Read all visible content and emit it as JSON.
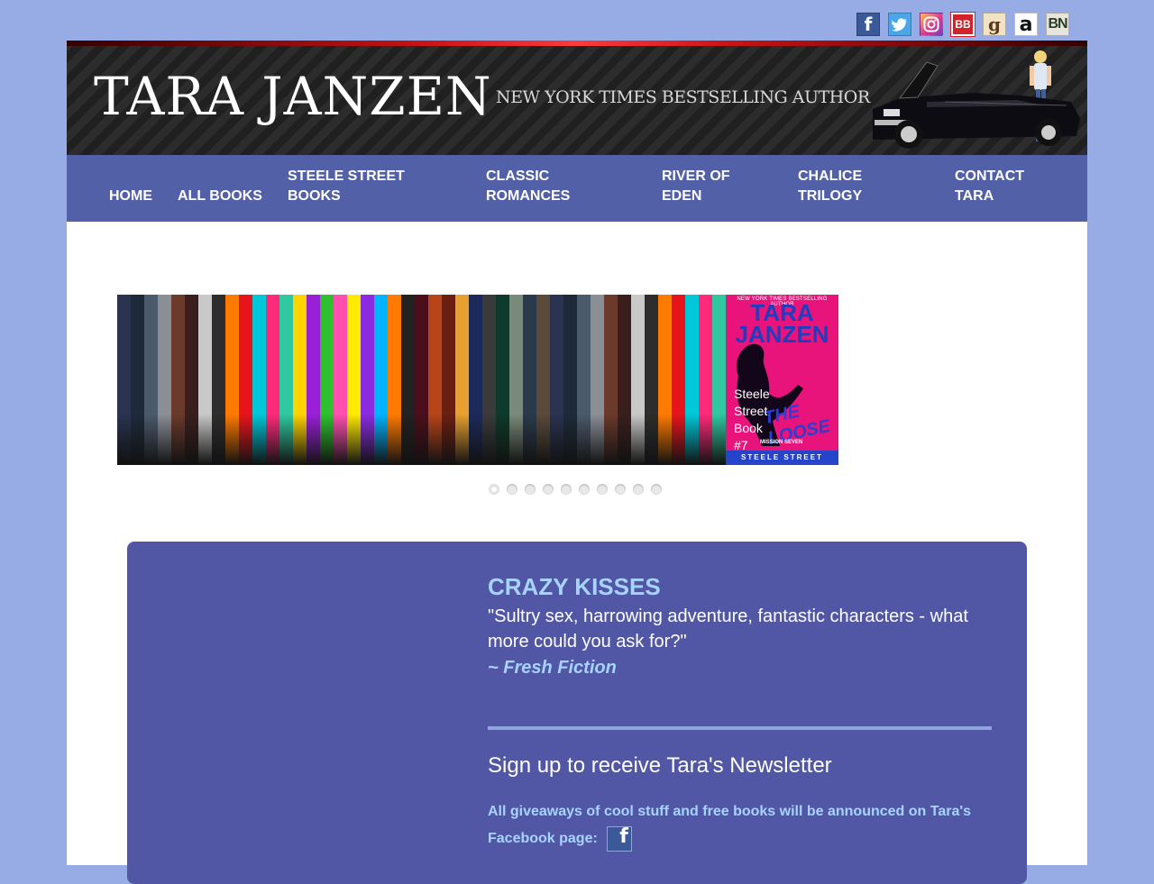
{
  "social": [
    {
      "name": "facebook-icon",
      "glyph": "f"
    },
    {
      "name": "twitter-icon",
      "glyph": "🐦"
    },
    {
      "name": "instagram-icon",
      "glyph": ""
    },
    {
      "name": "bookbub-icon",
      "glyph": "BB"
    },
    {
      "name": "goodreads-icon",
      "glyph": "g"
    },
    {
      "name": "amazon-icon",
      "glyph": "a"
    },
    {
      "name": "barnes-noble-icon",
      "glyph": "BN"
    }
  ],
  "header": {
    "brand": "TARA JANZEN",
    "tagline": "NEW YORK TIMES  BESTSELLING AUTHOR"
  },
  "nav": {
    "home": "HOME",
    "all_books": "ALL BOOKS",
    "steele_1": "STEELE STREET",
    "steele_2": "BOOKS",
    "classic_1": "CLASSIC",
    "classic_2": "ROMANCES",
    "river_1": "RIVER OF",
    "river_2": "EDEN",
    "chalice_1": "CHALICE",
    "chalice_2": "TRILOGY",
    "contact_1": "CONTACT",
    "contact_2": "TARA"
  },
  "slider": {
    "cover_banner": "NEW YORK TIMES BESTSELLING AUTHOR",
    "cover_author_1": "TARA",
    "cover_author_2": "JANZEN",
    "cover_title": "THE LOOSE",
    "cover_mission": "MISSION SEVEN",
    "cover_series": "STEELE STREET",
    "caption_lines": [
      "Steele",
      "Street",
      "Book",
      "#7"
    ],
    "dot_count": 10,
    "active_dot": 0,
    "colors": {
      "cover_pink": "#e8147c",
      "cover_blue": "#2544c9"
    }
  },
  "promo": {
    "title": "CRAZY KISSES",
    "quote": "\"Sultry sex, harrowing adventure, fantastic characters - what more could you ask for?\"",
    "source": "~ Fresh Fiction"
  },
  "newsletter": {
    "title": "Sign up to receive Tara's Newsletter",
    "note": "All giveaways of cool stuff and free books will be announced on Tara's Facebook page:",
    "fb_glyph": "f"
  },
  "colors": {
    "background": "#97abe5",
    "nav": "#5260a7",
    "panel": "#5157a4",
    "accent_text": "#a7d3ff"
  }
}
